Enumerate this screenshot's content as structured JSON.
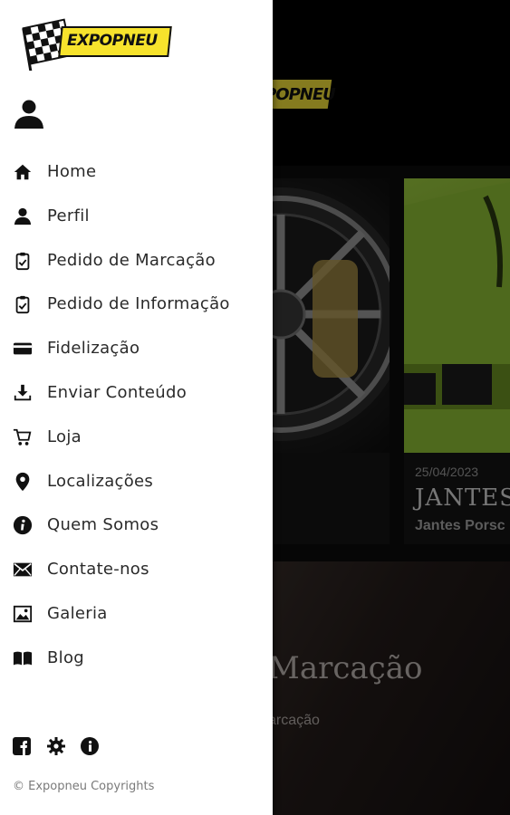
{
  "app": {
    "brand": "EXPOPNEU",
    "colors": {
      "brand_yellow": "#f7e32c",
      "drawer_bg": "#ffffff",
      "text": "#2a2a2a",
      "scrim": "rgba(0,0,0,0.45)"
    }
  },
  "background": {
    "cards": [
      {
        "date": "",
        "title": "",
        "subtitle": ""
      },
      {
        "date": "25/04/2023",
        "title": "JANTES P",
        "subtitle": "Jantes Porsc"
      }
    ],
    "hero": {
      "title": "Marcação",
      "subtitle": "arcação"
    }
  },
  "drawer": {
    "avatar_icon": "person-icon",
    "menu": [
      {
        "label": "Home",
        "icon": "home-icon"
      },
      {
        "label": "Perfil",
        "icon": "person-icon"
      },
      {
        "label": "Pedido de Marcação",
        "icon": "clipboard-icon"
      },
      {
        "label": "Pedido de Informação",
        "icon": "clipboard-icon"
      },
      {
        "label": "Fidelização",
        "icon": "credit-card-icon"
      },
      {
        "label": "Enviar Conteúdo",
        "icon": "download-icon"
      },
      {
        "label": "Loja",
        "icon": "cart-icon"
      },
      {
        "label": "Localizações",
        "icon": "location-pin-icon"
      },
      {
        "label": "Quem Somos",
        "icon": "info-icon"
      },
      {
        "label": "Contate-nos",
        "icon": "mail-icon"
      },
      {
        "label": "Galeria",
        "icon": "image-icon"
      },
      {
        "label": "Blog",
        "icon": "book-icon"
      }
    ],
    "footer_icons": [
      "facebook-icon",
      "settings-icon",
      "info-icon"
    ],
    "copyright": "© Expopneu Copyrights"
  }
}
